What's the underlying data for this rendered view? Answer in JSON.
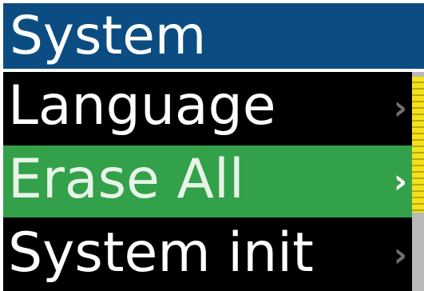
{
  "header": {
    "title": "System"
  },
  "menu": {
    "items": [
      {
        "label": "Language",
        "selected": false,
        "chevron": "›"
      },
      {
        "label": "Erase All",
        "selected": true,
        "chevron": "›"
      },
      {
        "label": "System init",
        "selected": false,
        "chevron": "›"
      }
    ]
  },
  "scrollbar": {
    "position_fraction": 0.0
  },
  "colors": {
    "header_bg": "#0b4d82",
    "menu_bg": "#000000",
    "selected_bg": "#33a14a",
    "scroll_thumb": "#f3e21c",
    "scroll_track": "#b9b9b9"
  },
  "icons": {
    "chevron": "chevron-right-icon"
  }
}
